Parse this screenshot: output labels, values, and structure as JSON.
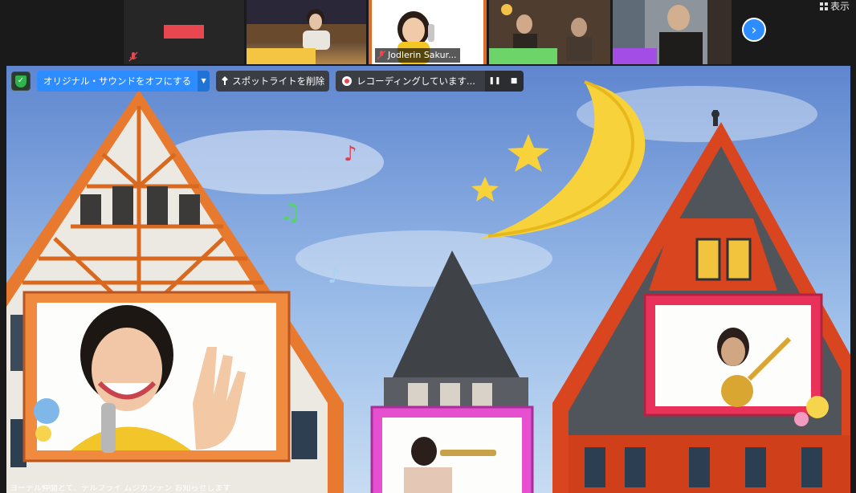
{
  "window": {
    "view_label": "表示"
  },
  "gallery": {
    "tiles": [
      {
        "id": "self",
        "accent": "#e8474f"
      },
      {
        "id": "tile-1",
        "accent": "#f4c542"
      },
      {
        "id": "tile-2",
        "name": "Jodlerin Sakur..."
      },
      {
        "id": "tile-3",
        "accent": "#6dd46a"
      },
      {
        "id": "tile-4",
        "accent": "#a34de6"
      }
    ],
    "next_icon": "chevron-right-icon"
  },
  "controls": {
    "original_sound": "オリジナル・サウンドをオフにする",
    "remove_spotlight": "スポットライトを削除",
    "recording": "レコーディングしています...",
    "pause_icon": "pause-icon",
    "stop_icon": "stop-icon"
  },
  "caption": {
    "text": "ヨーデル仲間とて、デルフライ ムジカンテン お知らせします"
  }
}
